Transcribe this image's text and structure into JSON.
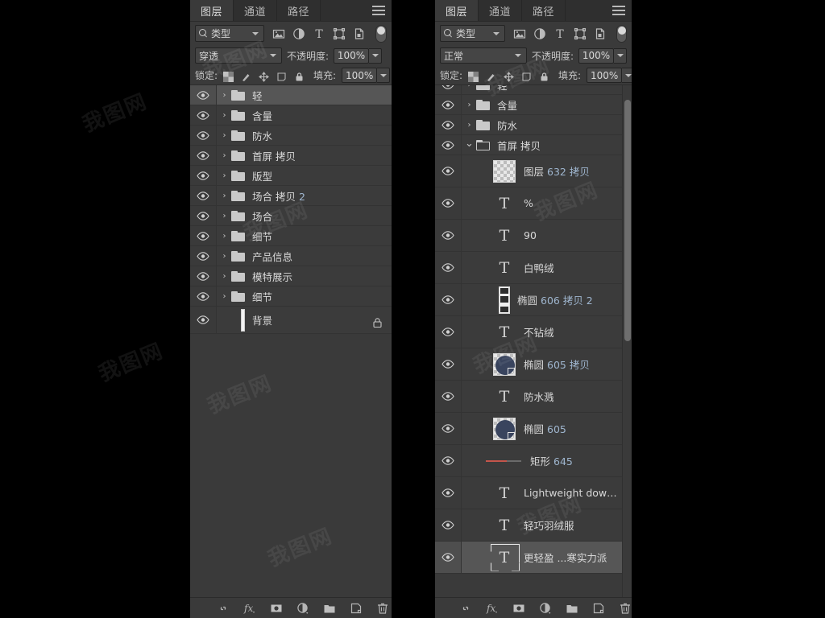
{
  "panels": {
    "left": {
      "tabs": [
        {
          "label": "图层",
          "active": true
        },
        {
          "label": "通道",
          "active": false
        },
        {
          "label": "路径",
          "active": false
        }
      ],
      "menu_icon": "hamburger-menu-icon",
      "filter": {
        "search_icon": "search-icon",
        "type_label": "类型",
        "icons": [
          "image-filter-icon",
          "adjustment-filter-icon",
          "text-filter-icon",
          "shape-filter-icon",
          "smart-object-filter-icon"
        ],
        "toggle": "filter-enable-toggle"
      },
      "blend": {
        "mode": "穿透",
        "opacity_label": "不透明度:",
        "opacity_value": "100%"
      },
      "lock": {
        "lock_label": "锁定:",
        "icons": [
          "lock-transparent-pixels-icon",
          "lock-image-pixels-icon",
          "lock-position-icon",
          "lock-artboard-icon",
          "lock-all-icon"
        ],
        "fill_label": "填充:",
        "fill_value": "100%"
      },
      "layers": [
        {
          "name": "轻",
          "kind": "group",
          "selected": true,
          "visible": true,
          "expanded": false
        },
        {
          "name": "含量",
          "kind": "group",
          "selected": false,
          "visible": true,
          "expanded": false
        },
        {
          "name": "防水",
          "kind": "group",
          "selected": false,
          "visible": true,
          "expanded": false
        },
        {
          "name": "首屏 拷贝",
          "kind": "group",
          "selected": false,
          "visible": true,
          "expanded": false
        },
        {
          "name": "版型",
          "kind": "group",
          "selected": false,
          "visible": true,
          "expanded": false
        },
        {
          "name": "场合 拷贝 2",
          "kind": "group",
          "selected": false,
          "visible": true,
          "expanded": false
        },
        {
          "name": "场合",
          "kind": "group",
          "selected": false,
          "visible": true,
          "expanded": false
        },
        {
          "name": "细节",
          "kind": "group",
          "selected": false,
          "visible": true,
          "expanded": false
        },
        {
          "name": "产品信息",
          "kind": "group",
          "selected": false,
          "visible": true,
          "expanded": false
        },
        {
          "name": "模特展示",
          "kind": "group",
          "selected": false,
          "visible": true,
          "expanded": false
        },
        {
          "name": "细节",
          "kind": "group",
          "selected": false,
          "visible": true,
          "expanded": false
        },
        {
          "name": "背景",
          "kind": "background",
          "selected": false,
          "visible": true,
          "locked": true
        }
      ],
      "bottom_icons": [
        "link-layers-icon",
        "layer-style-fx-icon",
        "add-mask-icon",
        "adjustment-layer-icon",
        "new-group-icon",
        "new-layer-icon",
        "delete-layer-icon"
      ]
    },
    "right": {
      "tabs": [
        {
          "label": "图层",
          "active": true
        },
        {
          "label": "通道",
          "active": false
        },
        {
          "label": "路径",
          "active": false
        }
      ],
      "menu_icon": "hamburger-menu-icon",
      "filter": {
        "search_icon": "search-icon",
        "type_label": "类型",
        "icons": [
          "image-filter-icon",
          "adjustment-filter-icon",
          "text-filter-icon",
          "shape-filter-icon",
          "smart-object-filter-icon"
        ],
        "toggle": "filter-enable-toggle"
      },
      "blend": {
        "mode": "正常",
        "opacity_label": "不透明度:",
        "opacity_value": "100%"
      },
      "lock": {
        "lock_label": "锁定:",
        "icons": [
          "lock-transparent-pixels-icon",
          "lock-image-pixels-icon",
          "lock-position-icon",
          "lock-artboard-icon",
          "lock-all-icon"
        ],
        "fill_label": "填充:",
        "fill_value": "100%"
      },
      "layers": [
        {
          "name": "轻",
          "kind": "group",
          "selected": false,
          "visible": true,
          "expanded": false,
          "clipped_top": true
        },
        {
          "name": "含量",
          "kind": "group",
          "selected": false,
          "visible": true,
          "expanded": false
        },
        {
          "name": "防水",
          "kind": "group",
          "selected": false,
          "visible": true,
          "expanded": false
        },
        {
          "name": "首屏 拷贝",
          "kind": "group",
          "selected": false,
          "visible": true,
          "expanded": true
        },
        {
          "name": "图层 632 拷贝",
          "kind": "raster",
          "selected": false,
          "visible": true,
          "name_base": "图层",
          "name_num": "632 拷贝"
        },
        {
          "name": "%",
          "kind": "text",
          "selected": false,
          "visible": true
        },
        {
          "name": "90",
          "kind": "text",
          "selected": false,
          "visible": true
        },
        {
          "name": "白鸭绒",
          "kind": "text",
          "selected": false,
          "visible": true
        },
        {
          "name": "椭圆 606 拷贝 2",
          "kind": "shape-narrow",
          "selected": false,
          "visible": true,
          "name_base": "椭圆",
          "name_num": "606 拷贝 2"
        },
        {
          "name": "不钻绒",
          "kind": "text",
          "selected": false,
          "visible": true
        },
        {
          "name": "椭圆 605 拷贝",
          "kind": "shape-circle",
          "selected": false,
          "visible": true,
          "name_base": "椭圆",
          "name_num": "605 拷贝"
        },
        {
          "name": "防水溅",
          "kind": "text",
          "selected": false,
          "visible": true
        },
        {
          "name": "椭圆 605",
          "kind": "shape-circle",
          "selected": false,
          "visible": true,
          "name_base": "椭圆",
          "name_num": "605"
        },
        {
          "name": "矩形 645",
          "kind": "shape-line",
          "selected": false,
          "visible": true,
          "name_base": "矩形",
          "name_num": "645"
        },
        {
          "name": "Lightweight down jacket",
          "kind": "text",
          "selected": false,
          "visible": true
        },
        {
          "name": "轻巧羽绒服",
          "kind": "text",
          "selected": false,
          "visible": true
        },
        {
          "name": "更轻盈 ...寒实力派",
          "kind": "text",
          "selected": true,
          "visible": true
        }
      ],
      "bottom_icons": [
        "link-layers-icon",
        "layer-style-fx-icon",
        "add-mask-icon",
        "adjustment-layer-icon",
        "new-group-icon",
        "new-layer-icon",
        "delete-layer-icon"
      ],
      "scrollbar": {
        "name": "layer-list-scrollbar"
      }
    }
  },
  "colors": {
    "panel_bg": "#3a3a3a",
    "tab_bg": "#2f2f2f",
    "row_selected": "#565656",
    "text": "#d8d8d8",
    "number_text": "#9fb6cf",
    "thumb_dark_blue": "#39445e",
    "line_red": "#c4554b"
  },
  "watermark": {
    "text": "我图网"
  }
}
